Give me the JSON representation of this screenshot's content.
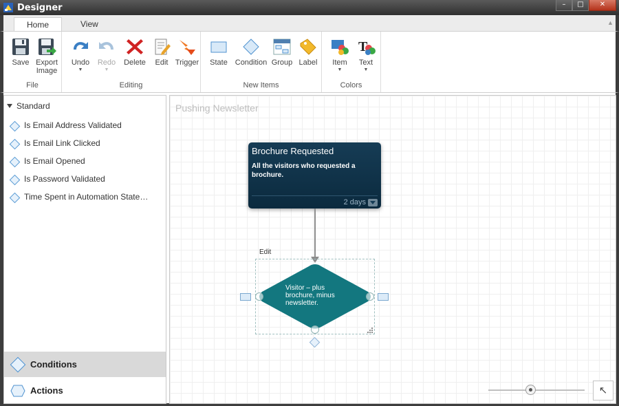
{
  "window": {
    "title": "Designer",
    "minimize": "–",
    "maximize": "□",
    "close": "✕"
  },
  "tabs": [
    {
      "label": "Home"
    },
    {
      "label": "View"
    }
  ],
  "ribbon": {
    "groups": [
      {
        "label": "File",
        "buttons": [
          {
            "label": "Save",
            "icon": "save-icon"
          },
          {
            "label": "Export Image",
            "icon": "export-image-icon"
          }
        ]
      },
      {
        "label": "Editing",
        "buttons": [
          {
            "label": "Undo",
            "icon": "undo-icon"
          },
          {
            "label": "Redo",
            "icon": "redo-icon",
            "disabled": true
          },
          {
            "label": "Delete",
            "icon": "delete-icon"
          },
          {
            "label": "Edit",
            "icon": "edit-icon"
          },
          {
            "label": "Trigger",
            "icon": "trigger-icon"
          }
        ]
      },
      {
        "label": "New Items",
        "buttons": [
          {
            "label": "State",
            "icon": "state-icon"
          },
          {
            "label": "Condition",
            "icon": "condition-icon"
          },
          {
            "label": "Group",
            "icon": "group-icon"
          },
          {
            "label": "Label",
            "icon": "label-icon"
          }
        ]
      },
      {
        "label": "Colors",
        "buttons": [
          {
            "label": "Item",
            "icon": "item-color-icon"
          },
          {
            "label": "Text",
            "icon": "text-color-icon"
          }
        ]
      }
    ]
  },
  "sidebar": {
    "section": "Standard",
    "items": [
      {
        "label": "Is Email Address Validated"
      },
      {
        "label": "Is Email Link Clicked"
      },
      {
        "label": "Is Email Opened"
      },
      {
        "label": "Is Password Validated"
      },
      {
        "label": "Time Spent in Automation State…"
      }
    ],
    "tabs": [
      {
        "label": "Conditions",
        "active": true
      },
      {
        "label": "Actions",
        "active": false
      }
    ]
  },
  "canvas": {
    "workflow_name": "Pushing Newsletter",
    "state": {
      "title": "Brochure Requested",
      "description": "All the visitors who requested a brochure.",
      "duration": "2 days"
    },
    "condition": {
      "edit_label": "Edit",
      "text": "Visitor – plus brochure, minus newsletter."
    },
    "fit_icon": "↖"
  },
  "colors": {
    "state_bg": "#0b2a3e",
    "condition_fill": "#13777f",
    "accent": "#4f92cf"
  }
}
